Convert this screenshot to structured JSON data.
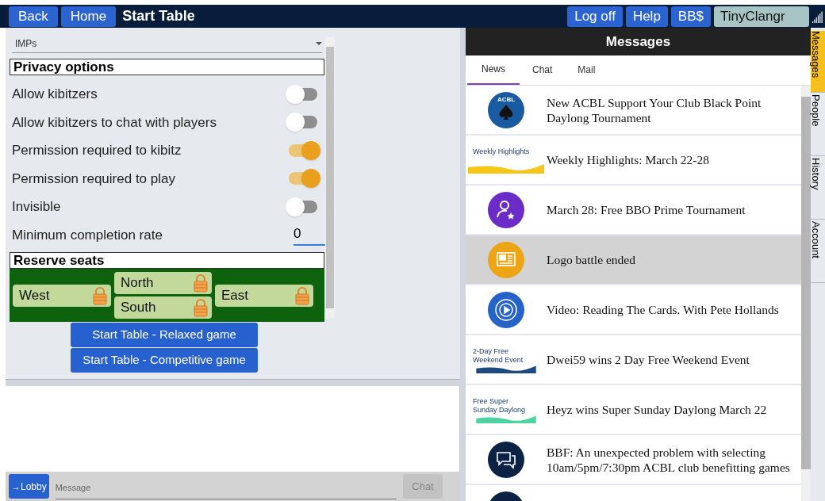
{
  "top_bar": {
    "nav_buttons": [
      "Back",
      "Home"
    ],
    "title": "Start Table",
    "right_buttons": [
      "Log off",
      "Help",
      "BB$"
    ],
    "username": "TinyClangr"
  },
  "scoring": {
    "value": "IMPs"
  },
  "privacy": {
    "heading": "Privacy options",
    "options": [
      {
        "kind": "toggle",
        "label": "Allow kibitzers",
        "on": false
      },
      {
        "kind": "toggle",
        "label": "Allow kibitzers to chat with players",
        "on": false
      },
      {
        "kind": "toggle",
        "label": "Permission required to kibitz",
        "on": true
      },
      {
        "kind": "toggle",
        "label": "Permission required to play",
        "on": true
      },
      {
        "kind": "toggle",
        "label": "Invisible",
        "on": false
      },
      {
        "kind": "number",
        "label": "Minimum completion rate",
        "value": "0"
      }
    ]
  },
  "reserve": {
    "heading": "Reserve seats",
    "seats": {
      "west": "West",
      "north": "North",
      "south": "South",
      "east": "East"
    }
  },
  "start_buttons": [
    "Start Table - Relaxed game",
    "Start Table - Competitive game"
  ],
  "chat_bar": {
    "lobby_button": "→Lobby",
    "placeholder": "Message",
    "send_button": "Chat"
  },
  "messages": {
    "title": "Messages",
    "tabs": [
      {
        "label": "News",
        "selected": true
      },
      {
        "label": "Chat",
        "selected": false
      },
      {
        "label": "Mail",
        "selected": false
      }
    ],
    "items": [
      {
        "kind": "acbl",
        "logo_text": "ACBL",
        "color": "#1a5aa0",
        "title": "New ACBL Support Your Club Black Point Daylong Tournament",
        "selected": false
      },
      {
        "kind": "banner",
        "banner": [
          "Weekly Highlights"
        ],
        "color": "#f5c518",
        "title": "Weekly Highlights: March 22-28",
        "selected": false
      },
      {
        "kind": "person",
        "color": "#6a2bc7",
        "title": "March 28: Free BBO Prime Tournament",
        "selected": false
      },
      {
        "kind": "news",
        "color": "#eea515",
        "title": "Logo battle ended",
        "selected": true
      },
      {
        "kind": "video",
        "color": "#2563c9",
        "title": "Video: Reading The Cards. With Pete Hollands",
        "selected": false
      },
      {
        "kind": "banner",
        "banner": [
          "2-Day Free",
          "Weekend Event"
        ],
        "color": "#1f4a80",
        "title": "Dwei59 wins 2 Day Free Weekend Event",
        "selected": false
      },
      {
        "kind": "banner",
        "banner": [
          "Free Super",
          "Sunday Daylong"
        ],
        "color": "#4ed3a0",
        "title": "Heyz wins Super Sunday Daylong March 22",
        "selected": false
      },
      {
        "kind": "chat",
        "color": "#0b2244",
        "title": "BBF: An unexpected problem with selecting 10am/5pm/7:30pm ACBL club benefitting games",
        "selected": false
      },
      {
        "kind": "chat",
        "color": "#0b2244",
        "selected": false
      }
    ]
  },
  "side_tabs": [
    {
      "label": "Messages",
      "selected": true
    },
    {
      "label": "People",
      "selected": false
    },
    {
      "label": "History",
      "selected": false
    },
    {
      "label": "Account",
      "selected": false
    }
  ]
}
